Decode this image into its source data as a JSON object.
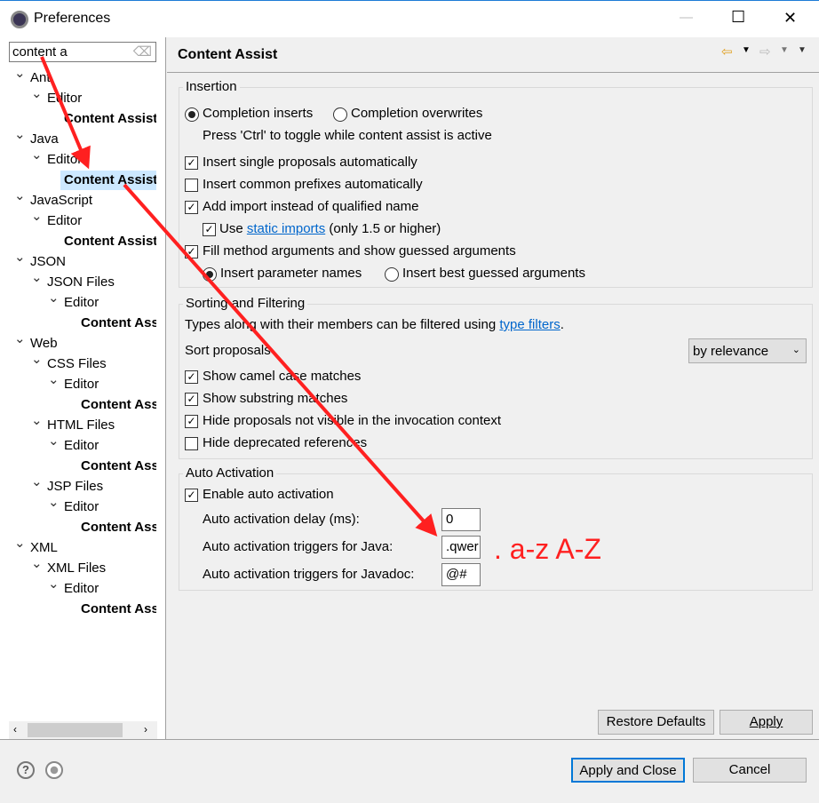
{
  "window": {
    "title": "Preferences",
    "minimize": "—",
    "maximize": "☐",
    "close": "✕"
  },
  "search": {
    "value": "content a"
  },
  "tree": [
    {
      "label": "Ant",
      "level": 0,
      "expanded": true
    },
    {
      "label": "Editor",
      "level": 1,
      "expanded": true
    },
    {
      "label": "Content Assist",
      "level": 2,
      "bold": true
    },
    {
      "label": "Java",
      "level": 0,
      "expanded": true
    },
    {
      "label": "Editor",
      "level": 1,
      "expanded": true
    },
    {
      "label": "Content Assist",
      "level": 2,
      "bold": true,
      "selected": true
    },
    {
      "label": "JavaScript",
      "level": 0,
      "expanded": true
    },
    {
      "label": "Editor",
      "level": 1,
      "expanded": false
    },
    {
      "label": "Content Assist",
      "level": 2,
      "bold": true
    },
    {
      "label": "JSON",
      "level": 0,
      "expanded": true
    },
    {
      "label": "JSON Files",
      "level": 1,
      "expanded": true
    },
    {
      "label": "Editor",
      "level": 2,
      "expanded": true
    },
    {
      "label": "Content Assist",
      "level": 3,
      "bold": true
    },
    {
      "label": "Web",
      "level": 0,
      "expanded": true
    },
    {
      "label": "CSS Files",
      "level": 1,
      "expanded": true
    },
    {
      "label": "Editor",
      "level": 2,
      "expanded": true
    },
    {
      "label": "Content Assist",
      "level": 3,
      "bold": true
    },
    {
      "label": "HTML Files",
      "level": 1,
      "expanded": true
    },
    {
      "label": "Editor",
      "level": 2,
      "expanded": true
    },
    {
      "label": "Content Assist",
      "level": 3,
      "bold": true
    },
    {
      "label": "JSP Files",
      "level": 1,
      "expanded": true
    },
    {
      "label": "Editor",
      "level": 2,
      "expanded": true
    },
    {
      "label": "Content Assist",
      "level": 3,
      "bold": true
    },
    {
      "label": "XML",
      "level": 0,
      "expanded": true
    },
    {
      "label": "XML Files",
      "level": 1,
      "expanded": true
    },
    {
      "label": "Editor",
      "level": 2,
      "expanded": true
    },
    {
      "label": "Content Assist",
      "level": 3,
      "bold": true
    }
  ],
  "page": {
    "title": "Content Assist"
  },
  "insertion": {
    "label": "Insertion",
    "completion_inserts": "Completion inserts",
    "completion_overwrites": "Completion overwrites",
    "toggle_hint": "Press 'Ctrl' to toggle while content assist is active",
    "insert_single": "Insert single proposals automatically",
    "insert_common": "Insert common prefixes automatically",
    "add_import": "Add import instead of qualified name",
    "use": "Use",
    "static_imports": "static imports",
    "only15": "(only 1.5 or higher)",
    "fill_method": "Fill method arguments and show guessed arguments",
    "param_names": "Insert parameter names",
    "best_guessed": "Insert best guessed arguments"
  },
  "sorting": {
    "label": "Sorting and Filtering",
    "types_text": "Types along with their members can be filtered using",
    "type_filters": "type filters",
    "period": ".",
    "sort_label": "Sort proposals",
    "sort_value": "by relevance",
    "camel": "Show camel case matches",
    "substring": "Show substring matches",
    "hide_invisible": "Hide proposals not visible in the invocation context",
    "hide_deprecated": "Hide deprecated references"
  },
  "auto": {
    "label": "Auto Activation",
    "enable": "Enable auto activation",
    "delay_label": "Auto activation delay (ms):",
    "delay_value": "0",
    "java_label": "Auto activation triggers for Java:",
    "java_value": ".qwer",
    "javadoc_label": "Auto activation triggers for Javadoc:",
    "javadoc_value": "@#"
  },
  "annotation": {
    "text": ". a-z A-Z",
    "color": "#ff2020"
  },
  "buttons": {
    "restore": "Restore Defaults",
    "apply": "Apply",
    "apply_close": "Apply and Close",
    "cancel": "Cancel"
  }
}
